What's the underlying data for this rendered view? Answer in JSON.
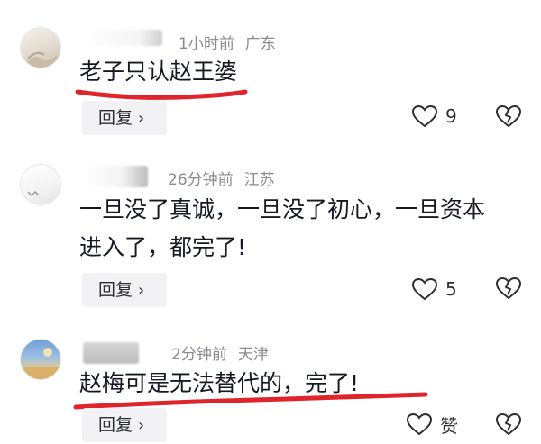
{
  "comments": [
    {
      "username": "",
      "time": "1小时前",
      "location": "广东",
      "text": "老子只认赵王婆",
      "reply_label": "回复",
      "reply_chevron": "›",
      "like_count": "9",
      "icons": {
        "like": "heart-icon",
        "dislike": "broken-heart-icon"
      }
    },
    {
      "username": "",
      "time": "26分钟前",
      "location": "江苏",
      "text_line1": "一旦没了真诚，一旦没了初心，一旦资本",
      "text_line2": "进入了，都完了!",
      "reply_label": "回复",
      "reply_chevron": "›",
      "like_count": "5",
      "icons": {
        "like": "heart-icon",
        "dislike": "broken-heart-icon"
      }
    },
    {
      "username": "",
      "time": "2分钟前",
      "location": "天津",
      "text": "赵梅可是无法替代的，完了!",
      "reply_label": "回复",
      "reply_chevron": "›",
      "like_count": "赞",
      "icons": {
        "like": "heart-icon",
        "dislike": "broken-heart-icon"
      }
    }
  ],
  "annotation_color": "#e0242b"
}
